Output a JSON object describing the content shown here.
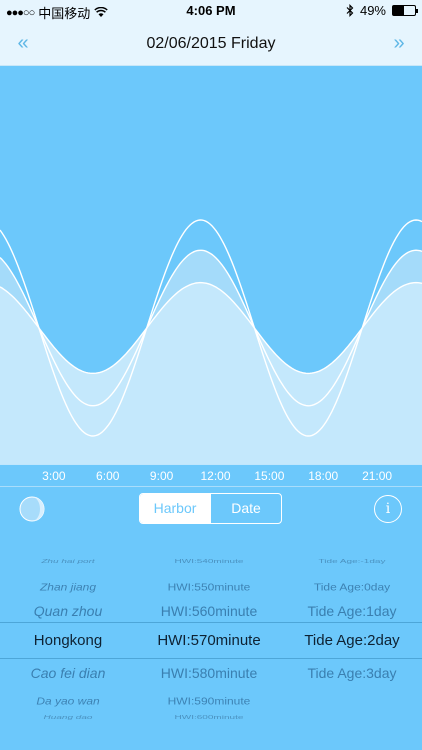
{
  "status_bar": {
    "carrier": "中国移动",
    "time": "4:06 PM",
    "battery": "49%",
    "battery_level": 0.49
  },
  "header": {
    "prev_label": "«",
    "title": "02/06/2015 Friday",
    "next_label": "»"
  },
  "chart_data": {
    "type": "area",
    "title": "",
    "x_ticks": [
      "3:00",
      "6:00",
      "9:00",
      "12:00",
      "15:00",
      "18:00",
      "21:00"
    ],
    "x_range_hours": [
      0,
      23.5
    ],
    "period_hours": 12,
    "crossing_hours": 8.17,
    "series": [
      {
        "amplitude": 1.0,
        "fill": "#6cc8fb"
      },
      {
        "amplitude": 0.72,
        "fill": "#a4dbfa"
      },
      {
        "amplitude": 0.42,
        "fill": "#c4e8fc"
      }
    ],
    "colors": {
      "background": "#6cc8fb",
      "line": "#ffffff"
    }
  },
  "toolbar": {
    "segments": [
      "Harbor",
      "Date"
    ],
    "selected": "Harbor",
    "info_label": "i"
  },
  "picker": {
    "rows": [
      {
        "harbor": "Zhu hai port",
        "hwi": "HWI:540minute",
        "age": "Tide Age:-1day"
      },
      {
        "harbor": "Zhan jiang",
        "hwi": "HWI:550minute",
        "age": "Tide Age:0day"
      },
      {
        "harbor": "Quan zhou",
        "hwi": "HWI:560minute",
        "age": "Tide Age:1day"
      },
      {
        "harbor": "Hongkong",
        "hwi": "HWI:570minute",
        "age": "Tide Age:2day"
      },
      {
        "harbor": "Cao fei dian",
        "hwi": "HWI:580minute",
        "age": "Tide Age:3day"
      },
      {
        "harbor": "Da yao wan",
        "hwi": "HWI:590minute",
        "age": ""
      },
      {
        "harbor": "Huang dao",
        "hwi": "HWI:600minute",
        "age": ""
      }
    ],
    "selected_index": 3
  }
}
